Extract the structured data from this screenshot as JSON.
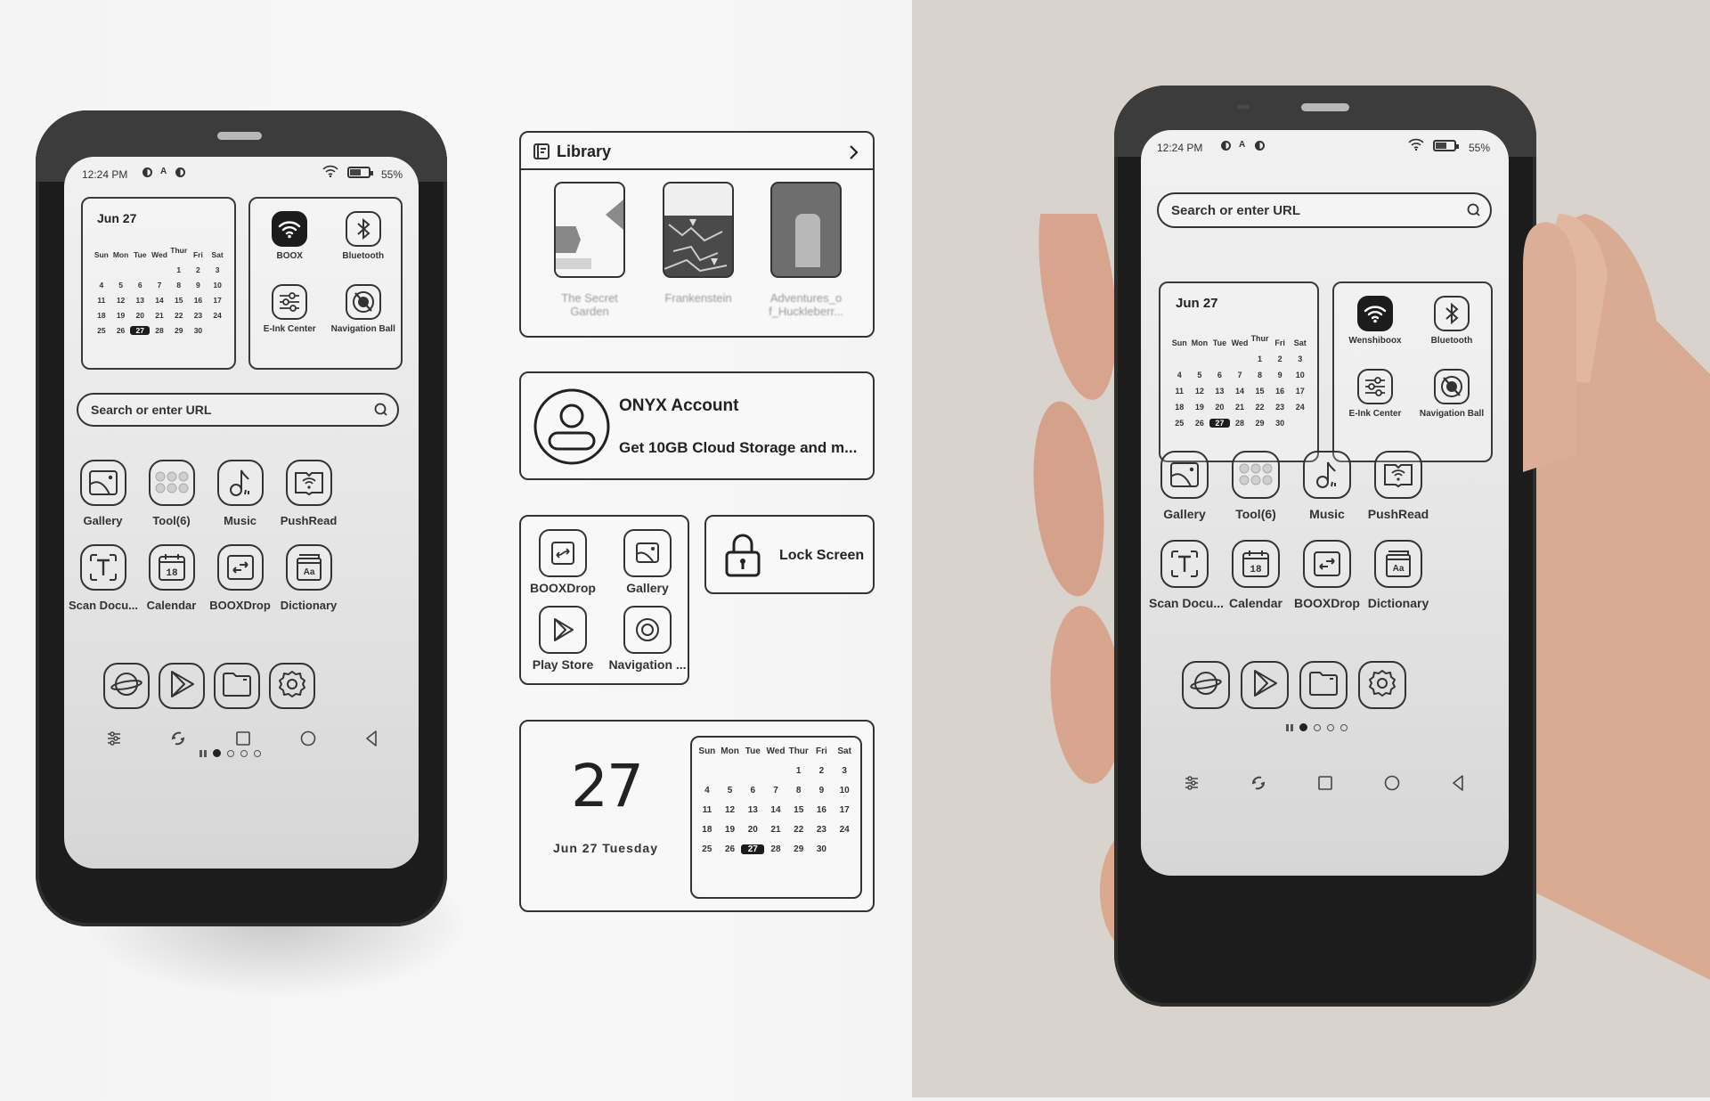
{
  "status_bar": {
    "time": "12:24 PM",
    "battery_percent": "55%",
    "battery_level": 0.55
  },
  "calendar_widget": {
    "title": "Jun 27",
    "weekdays": [
      "Sun",
      "Mon",
      "Tue",
      "Wed",
      "Thur",
      "Fri",
      "Sat"
    ],
    "days": [
      "",
      "",
      "",
      "",
      "1",
      "2",
      "3",
      "4",
      "5",
      "6",
      "7",
      "8",
      "9",
      "10",
      "11",
      "12",
      "13",
      "14",
      "15",
      "16",
      "17",
      "18",
      "19",
      "20",
      "21",
      "22",
      "23",
      "24",
      "25",
      "26",
      "27",
      "28",
      "29",
      "30",
      "",
      ""
    ],
    "today": "27"
  },
  "left_phone": {
    "quick_settings": [
      {
        "label": "BOOX",
        "icon": "wifi-icon"
      },
      {
        "label": "Bluetooth",
        "icon": "bluetooth-icon"
      },
      {
        "label": "E-Ink Center",
        "icon": "sliders-icon"
      },
      {
        "label": "Navigation Ball",
        "icon": "navigation-ball-icon"
      }
    ]
  },
  "right_phone": {
    "quick_settings": [
      {
        "label": "Wenshiboox",
        "icon": "wifi-icon"
      },
      {
        "label": "Bluetooth",
        "icon": "bluetooth-icon"
      },
      {
        "label": "E-Ink Center",
        "icon": "sliders-icon"
      },
      {
        "label": "Navigation Ball",
        "icon": "navigation-ball-icon"
      }
    ]
  },
  "search": {
    "placeholder": "Search or enter URL"
  },
  "apps": [
    {
      "label": "Gallery",
      "icon": "gallery-icon"
    },
    {
      "label": "Tool(6)",
      "icon": "tool-folder-icon"
    },
    {
      "label": "Music",
      "icon": "music-icon"
    },
    {
      "label": "PushRead",
      "icon": "pushread-icon"
    },
    {
      "label": "Scan Docu...",
      "icon": "scan-document-icon"
    },
    {
      "label": "Calendar",
      "icon": "calendar-icon",
      "icon_text": "18"
    },
    {
      "label": "BOOXDrop",
      "icon": "booxdrop-icon"
    },
    {
      "label": "Dictionary",
      "icon": "dictionary-icon",
      "icon_text": "Aa"
    }
  ],
  "pager": {
    "pages": 4,
    "active": 1
  },
  "dock": [
    {
      "name": "browser",
      "icon": "planet-icon"
    },
    {
      "name": "play-store",
      "icon": "play-store-icon"
    },
    {
      "name": "files",
      "icon": "folder-icon"
    },
    {
      "name": "settings",
      "icon": "gear-icon"
    }
  ],
  "navbar": [
    "control-center-icon",
    "refresh-icon",
    "recents-icon",
    "home-icon",
    "back-icon"
  ],
  "library_widget": {
    "title": "Library",
    "books": [
      {
        "title": "The Secret Garden"
      },
      {
        "title": "Frankenstein"
      },
      {
        "title": "Adventures_o f_Huckleberr..."
      }
    ]
  },
  "account_widget": {
    "title": "ONYX Account",
    "subtitle": "Get 10GB Cloud Storage and m..."
  },
  "app_folder_widget": {
    "apps": [
      {
        "label": "BOOXDrop",
        "icon": "booxdrop-icon"
      },
      {
        "label": "Gallery",
        "icon": "gallery-icon"
      },
      {
        "label": "Play Store",
        "icon": "play-store-icon"
      },
      {
        "label": "Navigation ...",
        "icon": "navigation-icon"
      }
    ]
  },
  "lock_widget": {
    "label": "Lock Screen"
  },
  "date_widget": {
    "day": "27",
    "date_line": "Jun 27 Tuesday"
  }
}
